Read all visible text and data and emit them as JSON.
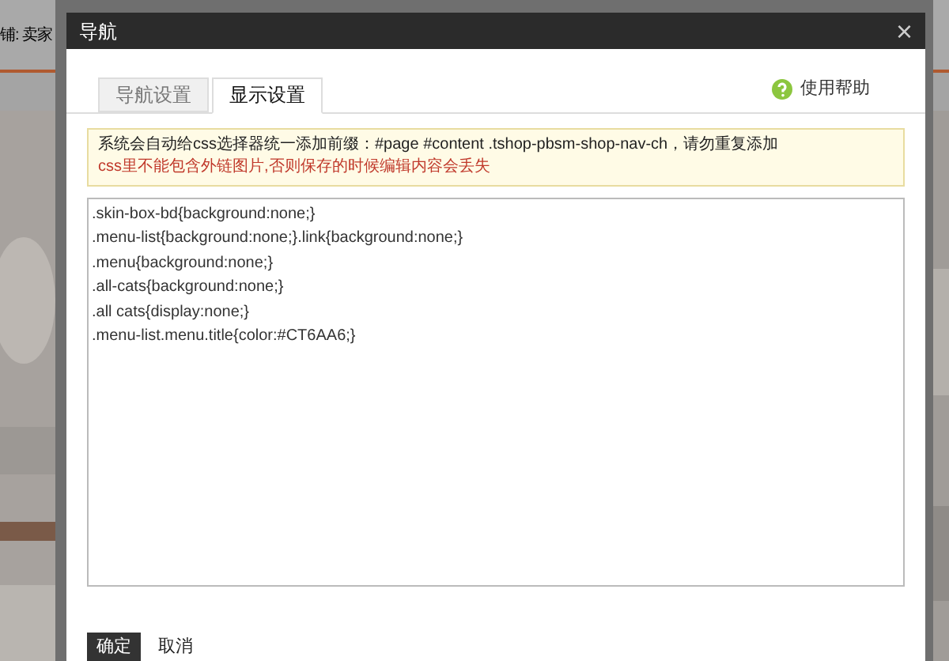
{
  "background_page": {
    "text": "铺: 卖家"
  },
  "dialog": {
    "title": "导航",
    "close": "×"
  },
  "tabs": [
    {
      "label": "导航设置",
      "selected": false
    },
    {
      "label": "显示设置",
      "selected": true
    }
  ],
  "help_link": "使用帮助",
  "notice": {
    "info": "系统会自动给css选择器统一添加前缀：#page #content .tshop-pbsm-shop-nav-ch，请勿重复添加",
    "warning": "css里不能包含外链图片,否则保存的时候编辑内容会丢失"
  },
  "css_code": [
    ".skin-box-bd{background:none;}",
    ".menu-list{background:none;}.link{background:none;}",
    ".menu{background:none;}",
    ".all-cats{background:none;}",
    ".all cats{display:none;}",
    ".menu-list.menu.title{color:#CT6AA6;}"
  ],
  "buttons": [
    {
      "label": "确定",
      "kind": "primary"
    },
    {
      "label": "取消",
      "kind": "plain"
    }
  ]
}
